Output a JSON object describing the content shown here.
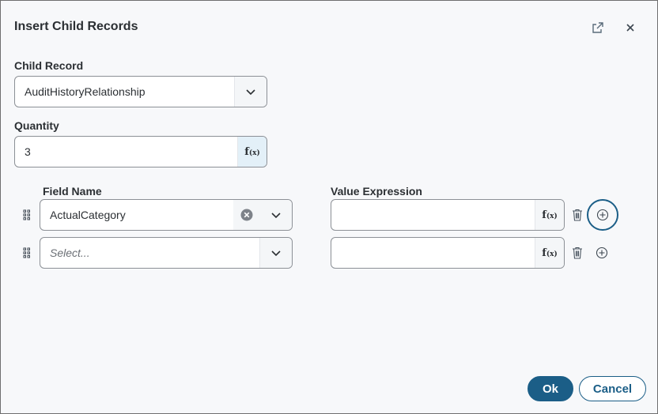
{
  "dialog": {
    "title": "Insert Child Records",
    "icons": {
      "popout": "popout-icon",
      "close": "close-icon"
    }
  },
  "child_record": {
    "label": "Child Record",
    "value": "AuditHistoryRelationship"
  },
  "quantity": {
    "label": "Quantity",
    "value": "3",
    "fx_label": "f(x)"
  },
  "mapping": {
    "field_name_header": "Field Name",
    "value_expression_header": "Value Expression",
    "rows": [
      {
        "field_value": "ActualCategory",
        "field_placeholder": "",
        "value_expression": "",
        "fx_label": "f(x)"
      },
      {
        "field_value": "",
        "field_placeholder": "Select...",
        "value_expression": "",
        "fx_label": "f(x)"
      }
    ]
  },
  "footer": {
    "ok_label": "Ok",
    "cancel_label": "Cancel"
  },
  "colors": {
    "primary": "#1b5e87",
    "background": "#f7f8fa",
    "border": "#8c9096"
  }
}
